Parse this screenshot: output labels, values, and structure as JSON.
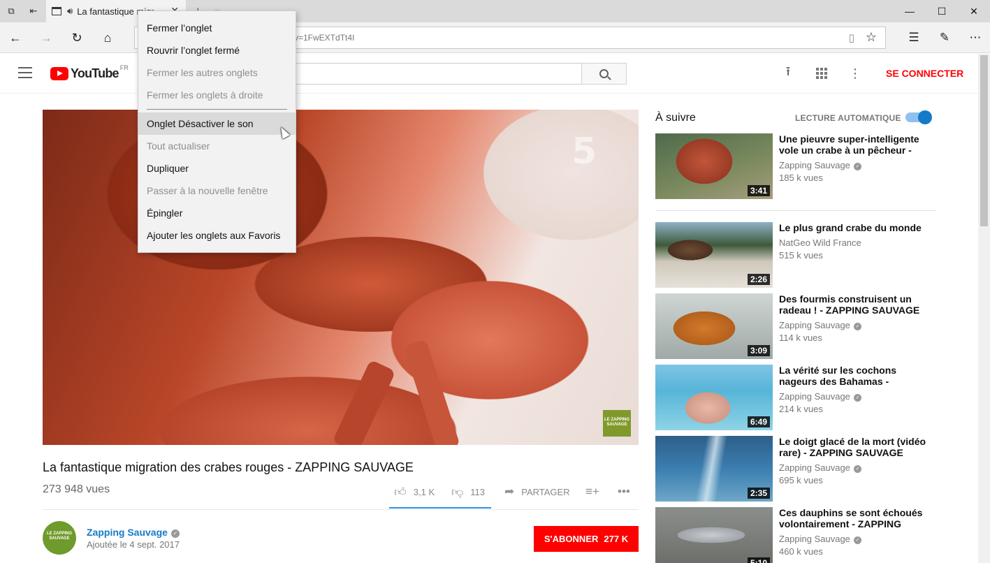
{
  "browser": {
    "tab": {
      "title": "La fantastique migr"
    },
    "url_fragment": "v=1FwEXTdTt4I",
    "window_controls": {
      "minimize": "—",
      "maximize": "☐",
      "close": "✕"
    }
  },
  "context_menu": {
    "items": [
      {
        "label": "Fermer l’onglet",
        "enabled": true
      },
      {
        "label": "Rouvrir l’onglet fermé",
        "enabled": true
      },
      {
        "label": "Fermer les autres onglets",
        "enabled": false
      },
      {
        "label": "Fermer les onglets à droite",
        "enabled": false
      },
      {
        "label": "Onglet Désactiver le son",
        "enabled": true,
        "hover": true
      },
      {
        "label": "Tout actualiser",
        "enabled": false
      },
      {
        "label": "Dupliquer",
        "enabled": true
      },
      {
        "label": "Passer à la nouvelle fenêtre",
        "enabled": false
      },
      {
        "label": "Épingler",
        "enabled": true
      },
      {
        "label": "Ajouter les onglets aux Favoris",
        "enabled": true
      }
    ]
  },
  "youtube": {
    "logo_text": "YouTube",
    "region": "FR",
    "signin": "SE CONNECTER",
    "colors": {
      "brand_red": "#ff0000",
      "link_blue": "#167ac6",
      "accent_blue": "#2793e6"
    }
  },
  "video": {
    "watermark": "5",
    "corner_logo": "LE ZAPPING SAUVAGE",
    "title": "La fantastique migration des crabes rouges - ZAPPING SAUVAGE",
    "views": "273 948 vues",
    "likes": "3,1 K",
    "dislikes": "113",
    "share": "PARTAGER",
    "like_ratio": 0.965
  },
  "channel": {
    "avatar_text": "LE ZAPPING SAUVAGE",
    "name": "Zapping Sauvage",
    "published": "Ajoutée le 4 sept. 2017",
    "subscribe": "S'ABONNER",
    "subscribers": "277 K"
  },
  "sidebar": {
    "up_next": "À suivre",
    "autoplay": "LECTURE AUTOMATIQUE",
    "autoplay_on": true,
    "videos": [
      {
        "title": "Une pieuvre super-intelligente vole un crabe à un pêcheur -",
        "channel": "Zapping Sauvage",
        "verified": true,
        "views": "185 k vues",
        "duration": "3:41"
      },
      {
        "title": "Le plus grand crabe du monde",
        "channel": "NatGeo Wild France",
        "verified": false,
        "views": "515 k vues",
        "duration": "2:26"
      },
      {
        "title": "Des fourmis construisent un radeau ! - ZAPPING SAUVAGE",
        "channel": "Zapping Sauvage",
        "verified": true,
        "views": "114 k vues",
        "duration": "3:09"
      },
      {
        "title": "La vérité sur les cochons nageurs des Bahamas -",
        "channel": "Zapping Sauvage",
        "verified": true,
        "views": "214 k vues",
        "duration": "6:49"
      },
      {
        "title": "Le doigt glacé de la mort (vidéo rare) - ZAPPING SAUVAGE",
        "channel": "Zapping Sauvage",
        "verified": true,
        "views": "695 k vues",
        "duration": "2:35"
      },
      {
        "title": "Ces dauphins se sont échoués volontairement - ZAPPING",
        "channel": "Zapping Sauvage",
        "verified": true,
        "views": "460 k vues",
        "duration": "5:10"
      }
    ]
  }
}
